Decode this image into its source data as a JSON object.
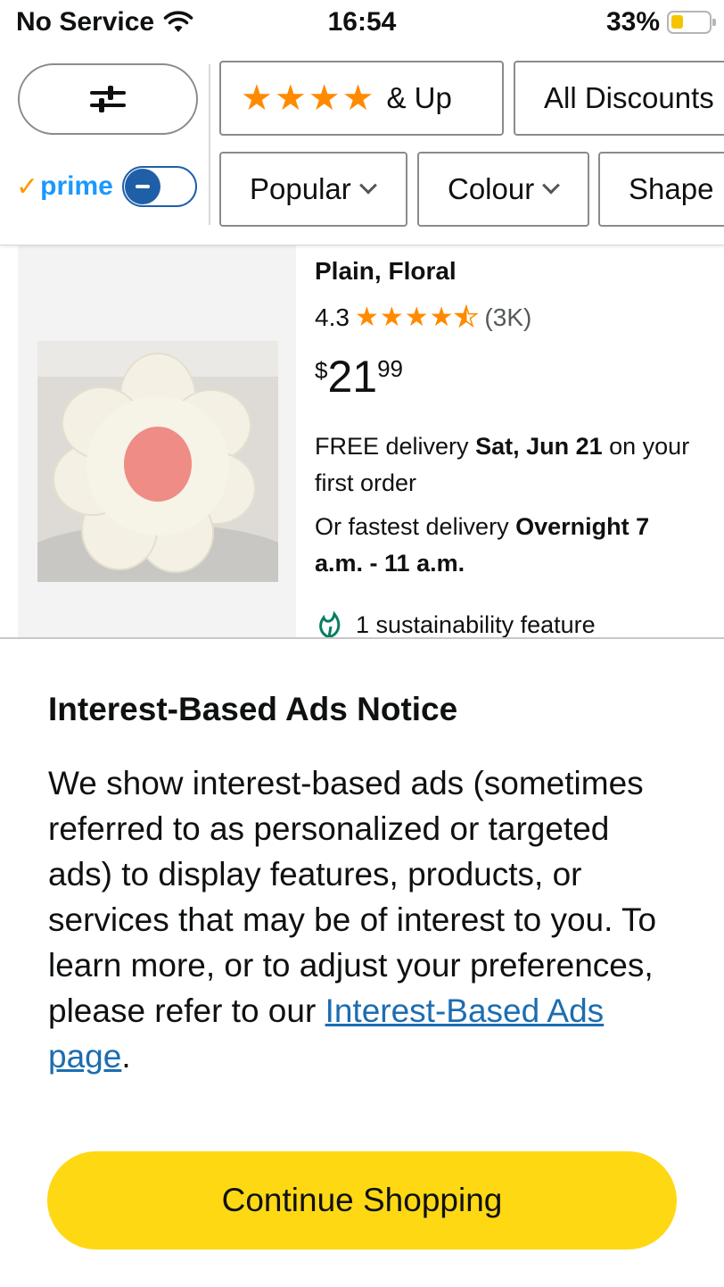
{
  "status_bar": {
    "carrier": "No Service",
    "time": "16:54",
    "battery_percent": "33%",
    "battery_level": 0.33,
    "battery_color": "#f5c400"
  },
  "filters": {
    "filter_icon": "sliders-icon",
    "prime_label": "prime",
    "prime_toggle_on": false,
    "chips_row1": [
      {
        "label": "★★★★ & Up",
        "stars": "★★★★",
        "suffix": "& Up"
      },
      {
        "label": "All Discounts"
      }
    ],
    "chips_row2": [
      {
        "label": "Popular"
      },
      {
        "label": "Colour"
      },
      {
        "label": "Shape"
      }
    ]
  },
  "product": {
    "title": "Plain, Floral",
    "rating": "4.3",
    "rating_count": "(3K)",
    "price_symbol": "$",
    "price_whole": "21",
    "price_fraction": "99",
    "delivery_prefix": "FREE delivery ",
    "delivery_date": "Sat, Jun 21",
    "delivery_suffix": " on your first order",
    "fastest_prefix": "Or fastest delivery ",
    "fastest_window": "Overnight 7 a.m. - 11 a.m.",
    "sustainability": "1 sustainability feature"
  },
  "modal": {
    "title": "Interest-Based Ads Notice",
    "body": "We show interest-based ads (sometimes referred to as personalized or targeted ads) to display features, products, or services that may be of interest to you. To learn more, or to adjust your preferences, please refer to our ",
    "link_text": "Interest-Based Ads page",
    "body_end": ".",
    "button_label": "Continue Shopping"
  },
  "colors": {
    "accent_yellow": "#ffd814",
    "star_orange": "#ff8a00",
    "link_blue": "#1c6db1",
    "prime_blue": "#1a98ff"
  }
}
